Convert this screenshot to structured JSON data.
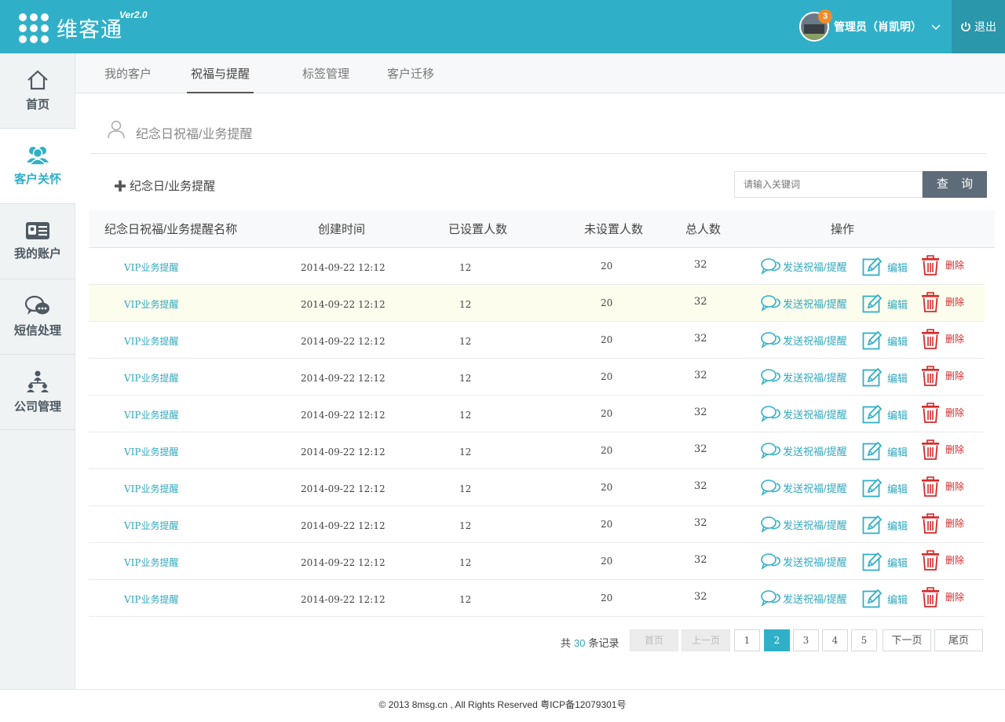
{
  "header": {
    "logo_text": "维客通",
    "version": "Ver2.0",
    "badge_count": "3",
    "user_name": "管理员（肖凯明）",
    "logout_label": "退出"
  },
  "sidebar": {
    "items": [
      {
        "label": "首页",
        "icon": "home-icon"
      },
      {
        "label": "客户关怀",
        "icon": "users-icon"
      },
      {
        "label": "我的账户",
        "icon": "id-card-icon"
      },
      {
        "label": "短信处理",
        "icon": "chat-icon"
      },
      {
        "label": "公司管理",
        "icon": "org-chart-icon"
      }
    ]
  },
  "tabs": [
    {
      "label": "我的客户"
    },
    {
      "label": "祝福与提醒"
    },
    {
      "label": "标签管理"
    },
    {
      "label": "客户迁移"
    }
  ],
  "section": {
    "title": "纪念日祝福/业务提醒",
    "add_label": "纪念日/业务提醒"
  },
  "search": {
    "placeholder": "请输入关键词",
    "button_label": "查 询"
  },
  "table": {
    "headers": [
      "纪念日祝福/业务提醒名称",
      "创建时间",
      "已设置人数",
      "未设置人数",
      "总人数",
      "操作"
    ],
    "actions": {
      "send": "发送祝福/提醒",
      "edit": "编辑",
      "delete": "删除"
    },
    "rows": [
      {
        "name": "VIP业务提醒",
        "time": "2014-09-22 12:12",
        "set": "12",
        "unset": "20",
        "total": "32"
      },
      {
        "name": "VIP业务提醒",
        "time": "2014-09-22 12:12",
        "set": "12",
        "unset": "20",
        "total": "32"
      },
      {
        "name": "VIP业务提醒",
        "time": "2014-09-22 12:12",
        "set": "12",
        "unset": "20",
        "total": "32"
      },
      {
        "name": "VIP业务提醒",
        "time": "2014-09-22 12:12",
        "set": "12",
        "unset": "20",
        "total": "32"
      },
      {
        "name": "VIP业务提醒",
        "time": "2014-09-22 12:12",
        "set": "12",
        "unset": "20",
        "total": "32"
      },
      {
        "name": "VIP业务提醒",
        "time": "2014-09-22 12:12",
        "set": "12",
        "unset": "20",
        "total": "32"
      },
      {
        "name": "VIP业务提醒",
        "time": "2014-09-22 12:12",
        "set": "12",
        "unset": "20",
        "total": "32"
      },
      {
        "name": "VIP业务提醒",
        "time": "2014-09-22 12:12",
        "set": "12",
        "unset": "20",
        "total": "32"
      },
      {
        "name": "VIP业务提醒",
        "time": "2014-09-22 12:12",
        "set": "12",
        "unset": "20",
        "total": "32"
      },
      {
        "name": "VIP业务提醒",
        "time": "2014-09-22 12:12",
        "set": "12",
        "unset": "20",
        "total": "32"
      }
    ]
  },
  "pagination": {
    "total_prefix": "共",
    "total_count": "30",
    "total_suffix": "条记录",
    "first": "首页",
    "prev": "上一页",
    "pages": [
      "1",
      "2",
      "3",
      "4",
      "5"
    ],
    "current_page": "2",
    "next": "下一页",
    "last": "尾页"
  },
  "footer": {
    "text": "© 2013 8msg.cn , All Rights Reserved 粤ICP备12079301号"
  },
  "colors": {
    "brand": "#30b0c8",
    "logout_bg": "#2a97ab",
    "delete": "#d42a2a",
    "search_button": "#5e6b78",
    "badge": "#f08c2a"
  }
}
